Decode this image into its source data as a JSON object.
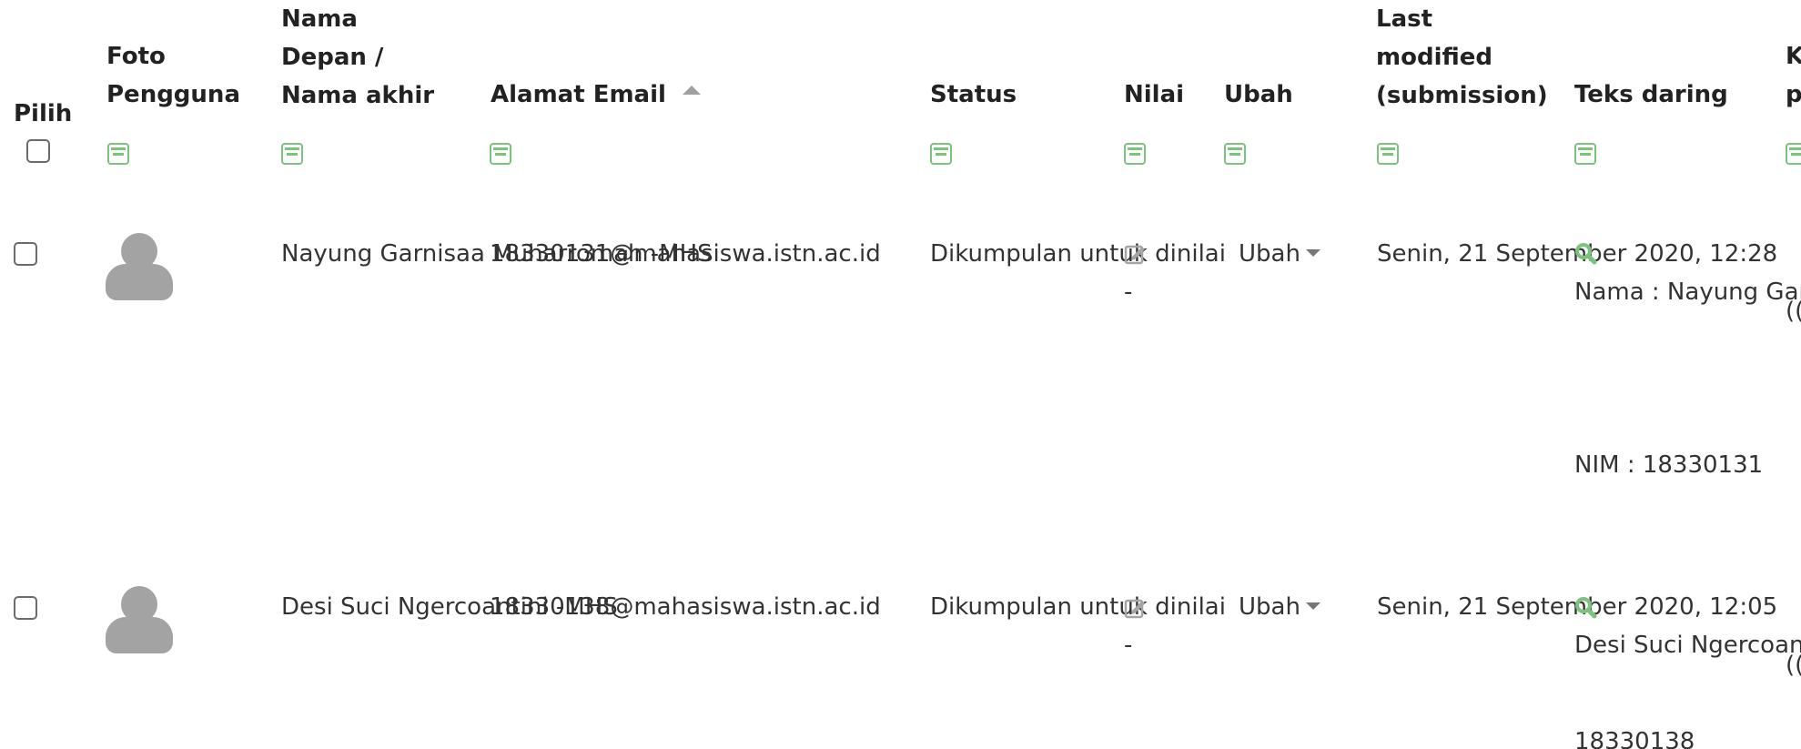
{
  "headers": {
    "pilih": "Pilih",
    "foto": "Foto\nPengguna",
    "nama": "Nama\nDepan /\nNama akhir",
    "email": "Alamat Email",
    "status": "Status",
    "nilai": "Nilai",
    "ubah": "Ubah",
    "last_modified": "Last\nmodified\n(submission)",
    "teks_daring": "Teks daring",
    "next_col": "K\np"
  },
  "rows": [
    {
      "name": "Nayung\nGarnisaa\nMuharromah\n-MHS",
      "email": "18330131@mahasiswa.istn.ac.id",
      "status": "Dikumpulan\nuntuk dinilai",
      "grade": "-",
      "ubah_label": "Ubah",
      "last_modified": "Senin, 21\nSeptember\n2020, 12:28",
      "online_text_1": "Nama :\nNayung\nGarnisaa\nMuharromah",
      "online_text_2": "NIM :\n18330131",
      "next_col": "(("
    },
    {
      "name": "Desi Suci\nNgercoantini\n-MHS",
      "email": "18330138@mahasiswa.istn.ac.id",
      "status": "Dikumpulan\nuntuk dinilai",
      "grade": "-",
      "ubah_label": "Ubah",
      "last_modified": "Senin, 21\nSeptember\n2020, 12:05",
      "online_text_1": "Desi Suci\nNgercoantini",
      "online_text_2": "18330138",
      "next_col": "(("
    }
  ],
  "colors": {
    "accent_green": "#7cc47e",
    "avatar_gray": "#a3a3a3",
    "text": "#333333"
  },
  "icons": {
    "collapse": "collapse-column-icon",
    "grade": "edit-grade-icon",
    "search": "search-icon",
    "avatar": "user-avatar-icon"
  }
}
